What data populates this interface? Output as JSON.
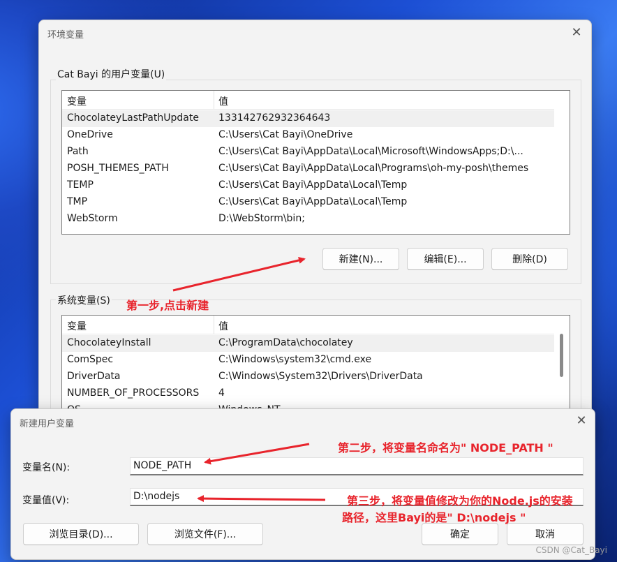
{
  "env_dialog": {
    "title": "环境变量",
    "close_glyph": "✕",
    "user_group_label": "Cat Bayi 的用户变量(U)",
    "system_group_label": "系统变量(S)",
    "columns": [
      "变量",
      "值"
    ],
    "user_vars": [
      {
        "name": "ChocolateyLastPathUpdate",
        "value": "133142762932364643"
      },
      {
        "name": "OneDrive",
        "value": "C:\\Users\\Cat Bayi\\OneDrive"
      },
      {
        "name": "Path",
        "value": "C:\\Users\\Cat Bayi\\AppData\\Local\\Microsoft\\WindowsApps;D:\\..."
      },
      {
        "name": "POSH_THEMES_PATH",
        "value": "C:\\Users\\Cat Bayi\\AppData\\Local\\Programs\\oh-my-posh\\themes"
      },
      {
        "name": "TEMP",
        "value": "C:\\Users\\Cat Bayi\\AppData\\Local\\Temp"
      },
      {
        "name": "TMP",
        "value": "C:\\Users\\Cat Bayi\\AppData\\Local\\Temp"
      },
      {
        "name": "WebStorm",
        "value": "D:\\WebStorm\\bin;"
      }
    ],
    "system_vars": [
      {
        "name": "ChocolateyInstall",
        "value": "C:\\ProgramData\\chocolatey"
      },
      {
        "name": "ComSpec",
        "value": "C:\\Windows\\system32\\cmd.exe"
      },
      {
        "name": "DriverData",
        "value": "C:\\Windows\\System32\\Drivers\\DriverData"
      },
      {
        "name": "NUMBER_OF_PROCESSORS",
        "value": "4"
      },
      {
        "name": "OS",
        "value": "Windows_NT"
      }
    ],
    "buttons": {
      "new": "新建(N)...",
      "edit": "编辑(E)...",
      "delete": "删除(D)"
    }
  },
  "new_var_dialog": {
    "title": "新建用户变量",
    "close_glyph": "✕",
    "name_label": "变量名(N):",
    "name_value": "NODE_PATH",
    "value_label": "变量值(V):",
    "value_value": "D:\\nodejs",
    "buttons": {
      "browse_dir": "浏览目录(D)...",
      "browse_file": "浏览文件(F)...",
      "ok": "确定",
      "cancel": "取消"
    }
  },
  "annotations": {
    "step1": "第一步,点击新建",
    "step2": "第二步，将变量名命名为\" NODE_PATH \"",
    "step3_line1": "第三步，将变量值修改为你的Node.js的安装",
    "step3_line2": "路径，这里Bayi的是\" D:\\nodejs \"",
    "color": "#e8242c"
  },
  "watermark": "CSDN @Cat_Bayi"
}
